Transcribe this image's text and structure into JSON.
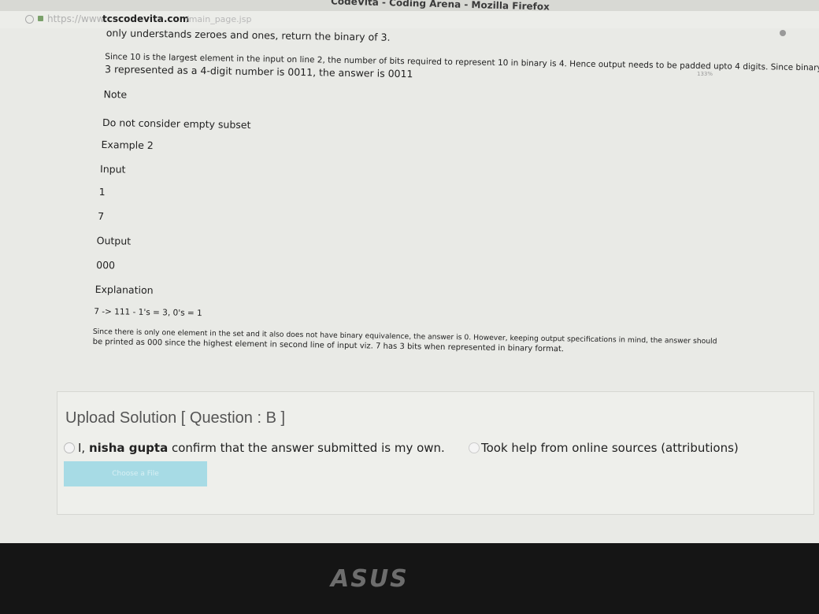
{
  "window": {
    "title": "CodeVita - Coding Arena - Mozilla Firefox"
  },
  "browser": {
    "url_prefix": "https://www.",
    "url_domain": "tcscodevita.com",
    "url_path": "/main_page.jsp",
    "zoom": "133%"
  },
  "problem": {
    "line_binary": "only understands zeroes and ones, return the binary of 3.",
    "line_since_1": "Since 10 is the largest element in the input on line 2, the number of bits required to represent 10 in binary is 4. Hence output needs to be padded upto 4 digits. Since binary",
    "line_since_2": "3 represented as a 4-digit number is 0011, the answer is 0011",
    "note_label": "Note",
    "note_text": "Do not consider empty subset",
    "example_label": "Example 2",
    "input_label": "Input",
    "input_line_1": "1",
    "input_line_2": "7",
    "output_label": "Output",
    "output_value": "000",
    "explanation_label": "Explanation",
    "explanation_calc": "7 -> 111 - 1's = 3, 0's = 1",
    "explanation_1": "Since there is only one element in the set and it also does not have binary equivalence, the answer is 0. However, keeping output specifications in mind, the answer should",
    "explanation_2": "be printed as 000 since the highest element in second line of input viz. 7 has 3 bits when represented in binary format."
  },
  "upload": {
    "heading": "Upload Solution [ Question : B ]",
    "confirm_prefix": "I, ",
    "user_name": "nisha gupta",
    "confirm_suffix": " confirm that the answer submitted is my own.",
    "help_option": "Took help from online sources (attributions)",
    "choose_file_label": "Choose a File"
  },
  "bezel": {
    "brand": "ASUS"
  }
}
